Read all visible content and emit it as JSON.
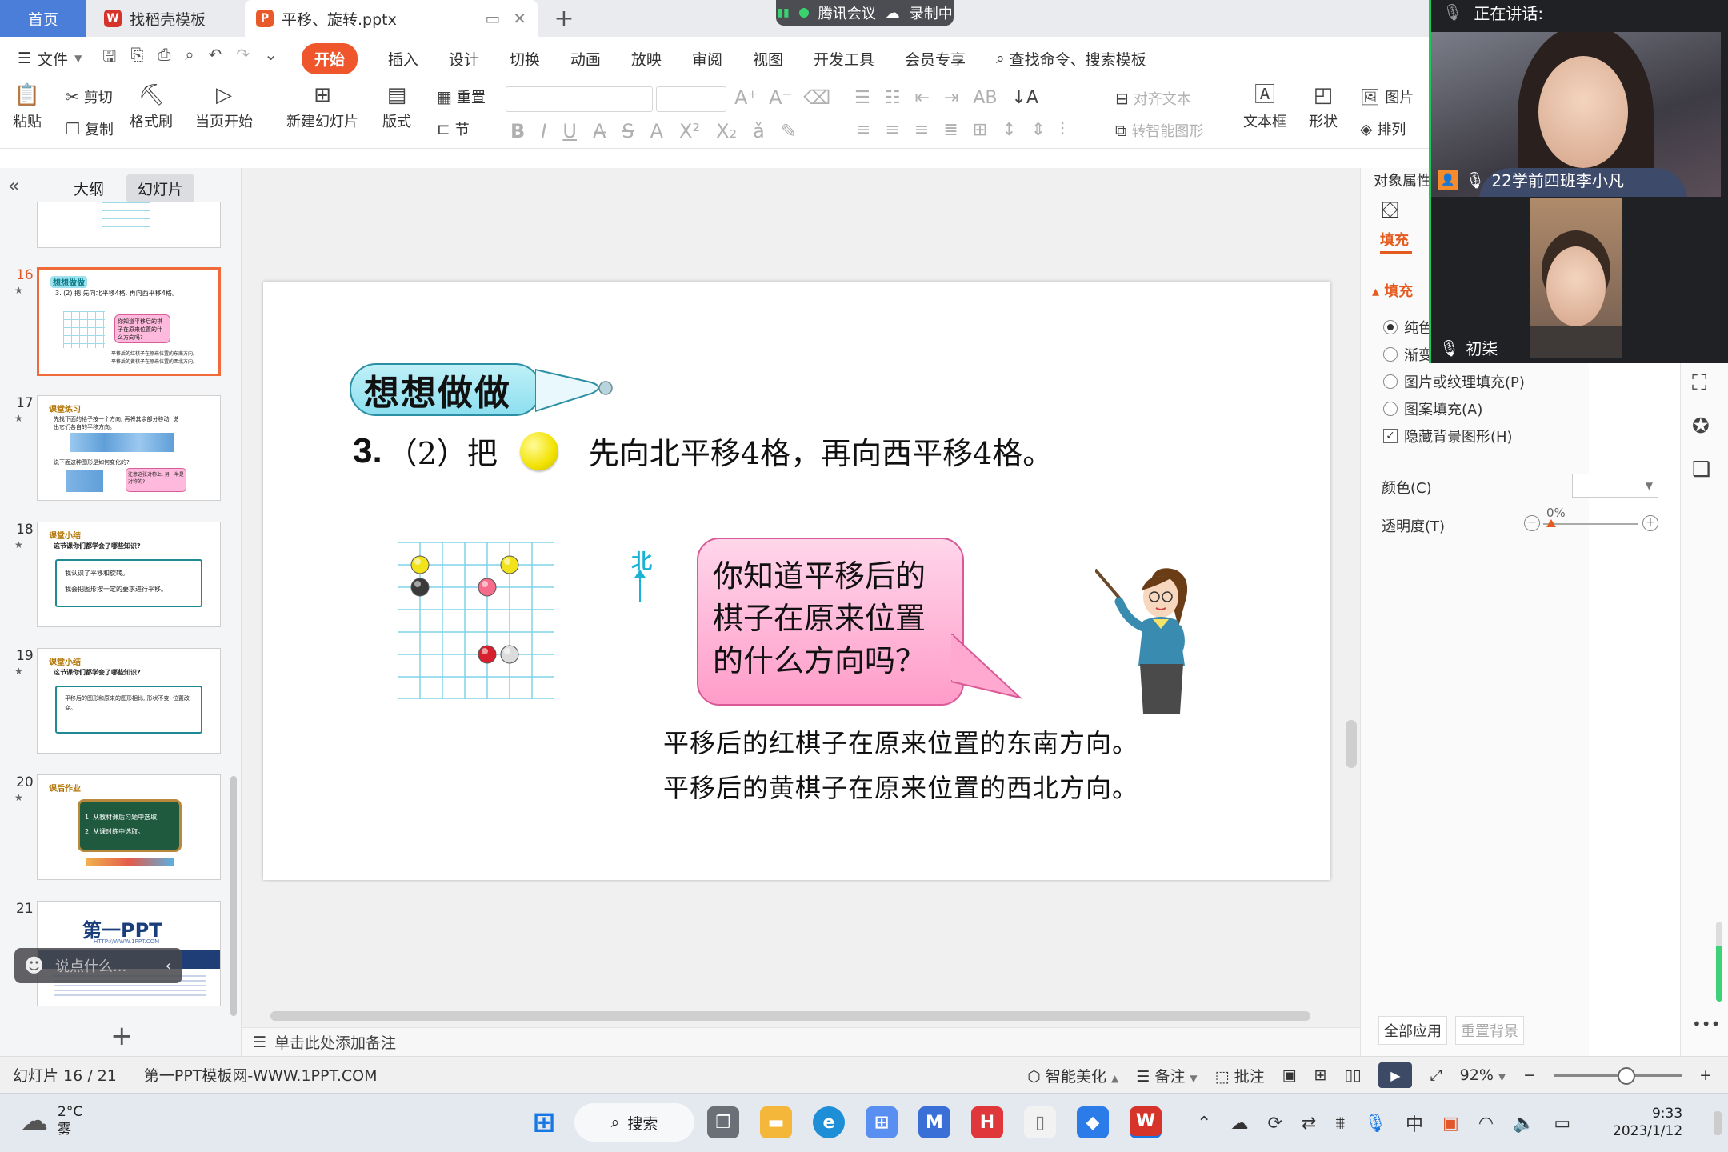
{
  "tabs": {
    "home": "首页",
    "template": "找稻壳模板",
    "file": "平移、旋转.pptx",
    "add": "+"
  },
  "meeting": {
    "app": "腾讯会议",
    "recording": "录制中"
  },
  "menu": {
    "file": "文件",
    "items": [
      "开始",
      "插入",
      "设计",
      "切换",
      "动画",
      "放映",
      "审阅",
      "视图",
      "开发工具",
      "会员专享"
    ],
    "search": "查找命令、搜索模板"
  },
  "ribbon": {
    "paste": "粘贴",
    "cut": "剪切",
    "copy": "复制",
    "format_painter": "格式刷",
    "from_current": "当页开始",
    "new_slide": "新建幻灯片",
    "layout": "版式",
    "reset": "重置",
    "section": "节",
    "align_text": "对齐文本",
    "smart_shape": "转智能图形",
    "textbox": "文本框",
    "shape": "形状",
    "picture": "图片",
    "arrange": "排列"
  },
  "left_panel": {
    "tab_outline": "大纲",
    "tab_slides": "幻灯片",
    "slides": [
      {
        "num": "16",
        "tag": "想想做做",
        "line1": "3. (2) 把   先向北平移4格, 再向西平移4格。",
        "bubble": "你知道平移后的棋子在原来位置的什么方向吗?",
        "ans1": "平移后的红棋子在原来位置的东南方向。",
        "ans2": "平移后的黄棋子在原来位置的西北方向。"
      },
      {
        "num": "17",
        "tag": "课堂练习",
        "line1": "先找下面的格子按一个方向, 再将其余部分移动, 说",
        "line2": "出它们各自的平移方向。",
        "line3": "说下面这种图形是如何变化的?",
        "line4": "注意这张对称上, 另一半是对称的?"
      },
      {
        "num": "18",
        "tag": "课堂小结",
        "line1": "这节课你们都学会了哪些知识?",
        "line2": "我认识了平移和旋转。",
        "line3": "我会把图形按一定的要求进行平移。"
      },
      {
        "num": "19",
        "tag": "课堂小结",
        "line1": "这节课你们都学会了哪些知识?",
        "line2": "平移后的图形和原来的图形相比, 形状不变, 位置改变。"
      },
      {
        "num": "20",
        "tag": "课后作业",
        "line1": "1. 从教材课后习题中选取;",
        "line2": "2. 从课时练中选取。"
      },
      {
        "num": "21",
        "title": "第一PPT",
        "url": "HTTP://WWW.1PPT.COM"
      }
    ],
    "chat_placeholder": "说点什么..."
  },
  "slide": {
    "heading": "想想做做",
    "problem_num": "3.",
    "problem_pre": "（2）把",
    "problem_post": "先向北平移4格，再向西平移4格。",
    "north": "北",
    "bubble": "你知道平移后的棋子在原来位置的什么方向吗？",
    "answer_1": "平移后的红棋子在原来位置的东南方向。",
    "answer_2": "平移后的黄棋子在原来位置的西北方向。",
    "grid": {
      "cols": 7,
      "rows": 7,
      "pieces": [
        {
          "color": "yellow",
          "col": 1,
          "row": 1
        },
        {
          "color": "yellow",
          "col": 5,
          "row": 1
        },
        {
          "color": "black",
          "col": 1,
          "row": 2
        },
        {
          "color": "pink",
          "col": 4,
          "row": 2
        },
        {
          "color": "red",
          "col": 4,
          "row": 5
        },
        {
          "color": "white",
          "col": 5,
          "row": 5
        }
      ]
    }
  },
  "notes_placeholder": "单击此处添加备注",
  "props": {
    "title": "对象属性",
    "fill_tab": "填充",
    "fill_section": "填充",
    "opt_solid": "纯色",
    "opt_gradient": "渐变",
    "opt_picture": "图片或纹理填充(P)",
    "opt_pattern": "图案填充(A)",
    "opt_hide_bg": "隐藏背景图形(H)",
    "color_label": "颜色(C)",
    "transparency_label": "透明度(T)",
    "transparency_value": "0%",
    "apply_all": "全部应用",
    "reset_bg": "重置背景"
  },
  "video": {
    "speaking": "正在讲话:",
    "participant_1": "22学前四班李小凡",
    "participant_2": "初柒"
  },
  "status": {
    "slide_info": "幻灯片 16 / 21",
    "template": "第一PPT模板网-WWW.1PPT.COM",
    "beautify": "智能美化",
    "notes": "备注",
    "comments": "批注",
    "zoom": "92%"
  },
  "taskbar": {
    "temp": "2°C",
    "weather": "雾",
    "search": "搜索",
    "ime": "中",
    "time": "9:33",
    "date": "2023/1/12"
  },
  "colors": {
    "accent": "#f0562b",
    "meeting_green": "#21c65b",
    "slide_cyan": "#1ab3d6",
    "bubble_pink": "#ff9cc9"
  }
}
